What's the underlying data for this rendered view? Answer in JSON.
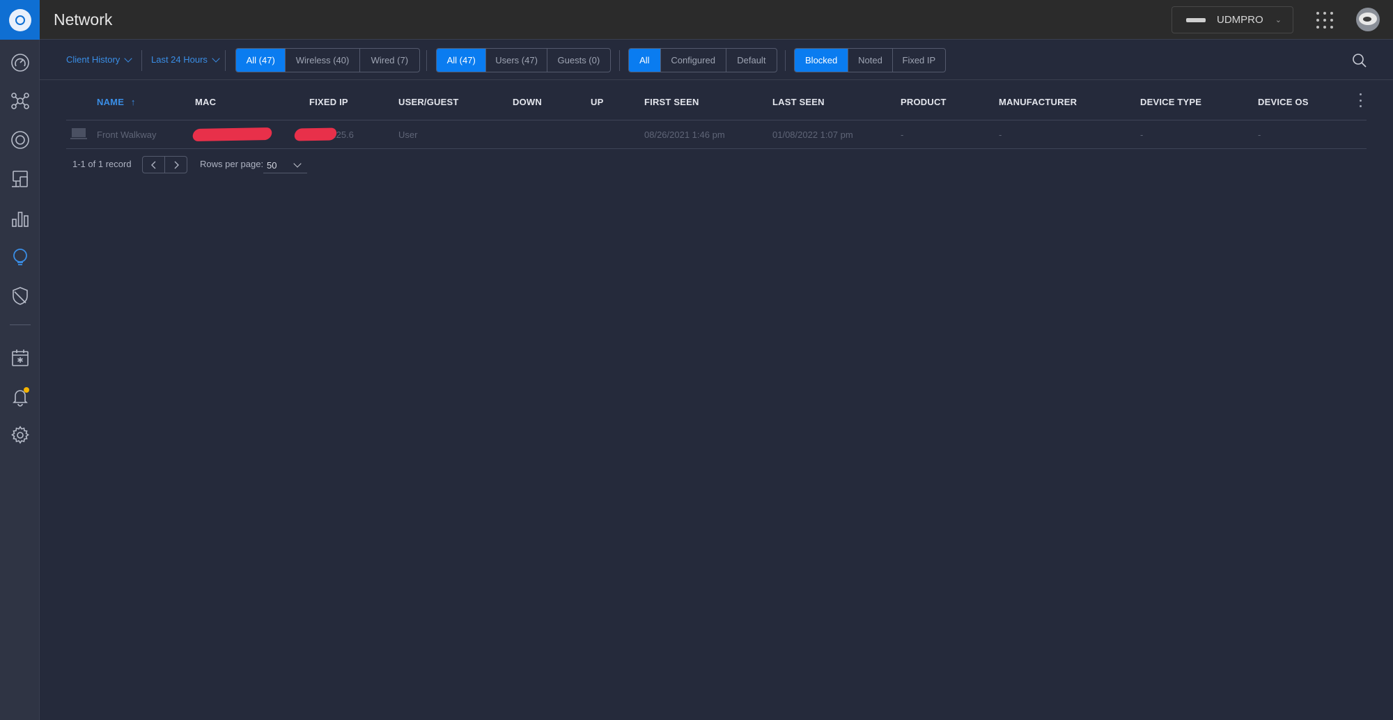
{
  "header": {
    "app_title": "Network",
    "device_name": "UDMPRO"
  },
  "sidebar": {
    "items": [
      {
        "name": "dashboard"
      },
      {
        "name": "topology"
      },
      {
        "name": "statistics"
      },
      {
        "name": "devices"
      },
      {
        "name": "insights"
      },
      {
        "name": "clients"
      },
      {
        "name": "security"
      },
      {
        "name": "events"
      },
      {
        "name": "alerts"
      },
      {
        "name": "settings"
      }
    ],
    "alert_badge_color": "#f5b400",
    "active_color": "#3a8ee6"
  },
  "filters": {
    "view_dropdown": "Client History",
    "time_dropdown": "Last 24 Hours",
    "connection": [
      "All (47)",
      "Wireless (40)",
      "Wired (7)"
    ],
    "connection_active": "All (47)",
    "user_type": [
      "All (47)",
      "Users (47)",
      "Guests (0)"
    ],
    "user_type_active": "All (47)",
    "config": [
      "All",
      "Configured",
      "Default"
    ],
    "config_active": "All",
    "status": [
      "Blocked",
      "Noted",
      "Fixed IP"
    ],
    "status_active": "Blocked"
  },
  "table": {
    "columns": [
      "NAME",
      "MAC",
      "FIXED IP",
      "USER/GUEST",
      "DOWN",
      "UP",
      "FIRST SEEN",
      "LAST SEEN",
      "PRODUCT",
      "MANUFACTURER",
      "DEVICE TYPE",
      "DEVICE OS"
    ],
    "sort_arrow": "↑",
    "rows": [
      {
        "name": "Front Walkway",
        "mac": "",
        "fixed_ip": ".25.6",
        "user_guest": "User",
        "down": "",
        "up": "",
        "first_seen": "08/26/2021 1:46 pm",
        "last_seen": "01/08/2022 1:07 pm",
        "product": "-",
        "manufacturer": "-",
        "device_type": "-",
        "device_os": "-"
      }
    ]
  },
  "pagination": {
    "record_count": "1-1 of 1 record",
    "rows_per_page_label": "Rows per page:",
    "rows_per_page_value": "50"
  },
  "colors": {
    "accent": "#0a7cf0",
    "redaction": "#e8304a",
    "background": "#252a3b"
  }
}
